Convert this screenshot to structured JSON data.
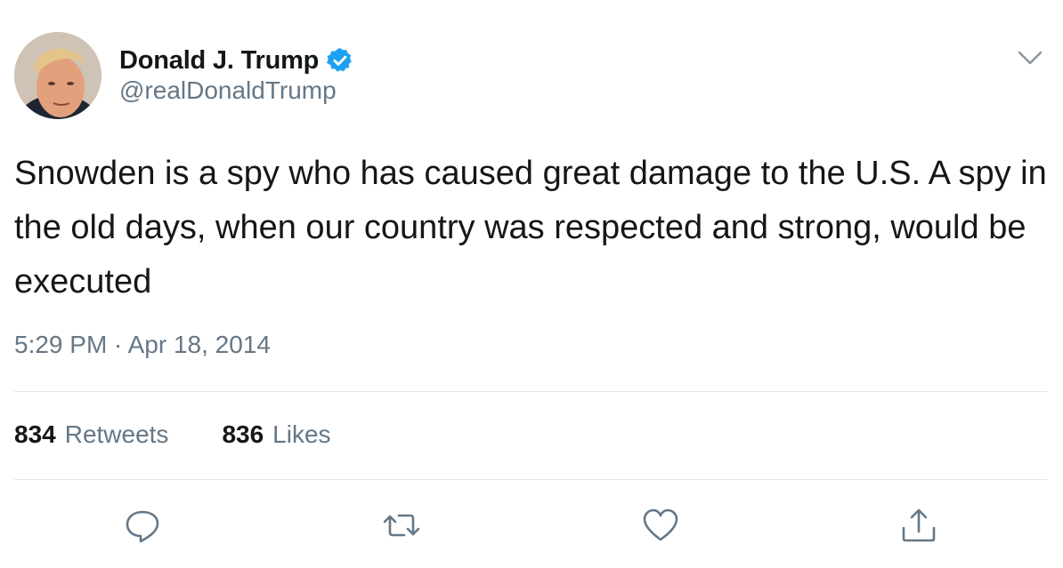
{
  "user": {
    "display_name": "Donald J. Trump",
    "handle": "@realDonaldTrump",
    "verified": true
  },
  "tweet": {
    "text": "Snowden is a spy who has caused great damage to the U.S. A spy in the old days, when our country was respected and strong, would be executed",
    "timestamp": "5:29 PM · Apr 18, 2014"
  },
  "stats": {
    "retweets_count": "834",
    "retweets_label": "Retweets",
    "likes_count": "836",
    "likes_label": "Likes"
  },
  "actions": [
    {
      "icon": "reply-icon"
    },
    {
      "icon": "retweet-icon"
    },
    {
      "icon": "like-icon"
    },
    {
      "icon": "share-icon"
    }
  ],
  "colors": {
    "text": "#14171a",
    "secondary": "#657786",
    "divider": "#e1e8ed",
    "verified": "#1da1f2"
  }
}
